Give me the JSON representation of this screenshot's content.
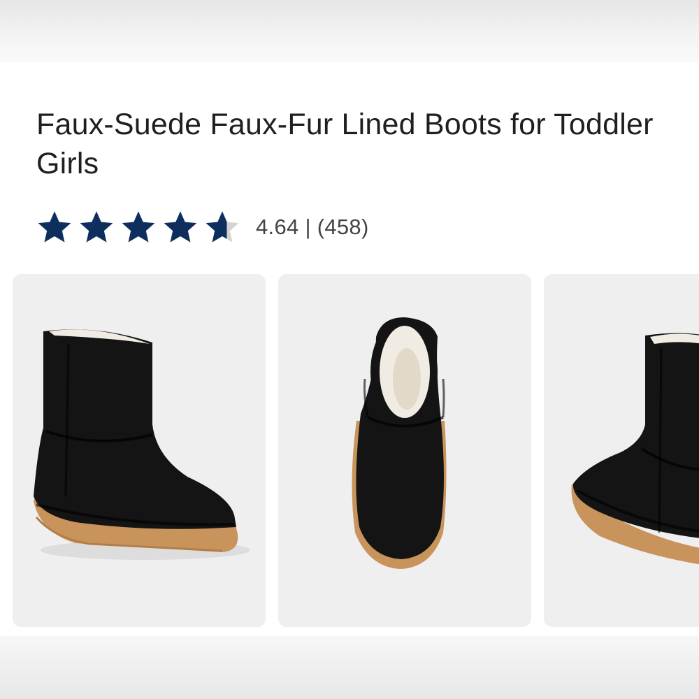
{
  "product": {
    "title": "Faux-Suede Faux-Fur Lined Boots for Toddler Girls"
  },
  "rating": {
    "value": 4.64,
    "max": 5,
    "text": "4.64 | (458)",
    "count": 458,
    "star_color": "#0e2f5e",
    "star_empty_color": "#d3d3d3"
  },
  "gallery": {
    "images": [
      {
        "icon": "boot-side-view-image",
        "view": "side"
      },
      {
        "icon": "boot-top-view-image",
        "view": "top"
      },
      {
        "icon": "boot-angled-view-image",
        "view": "angled"
      }
    ]
  },
  "colors": {
    "boot": "#141414",
    "sole": "#c9945c",
    "fur": "#f1ece3",
    "photo_bg": "#efefef"
  }
}
